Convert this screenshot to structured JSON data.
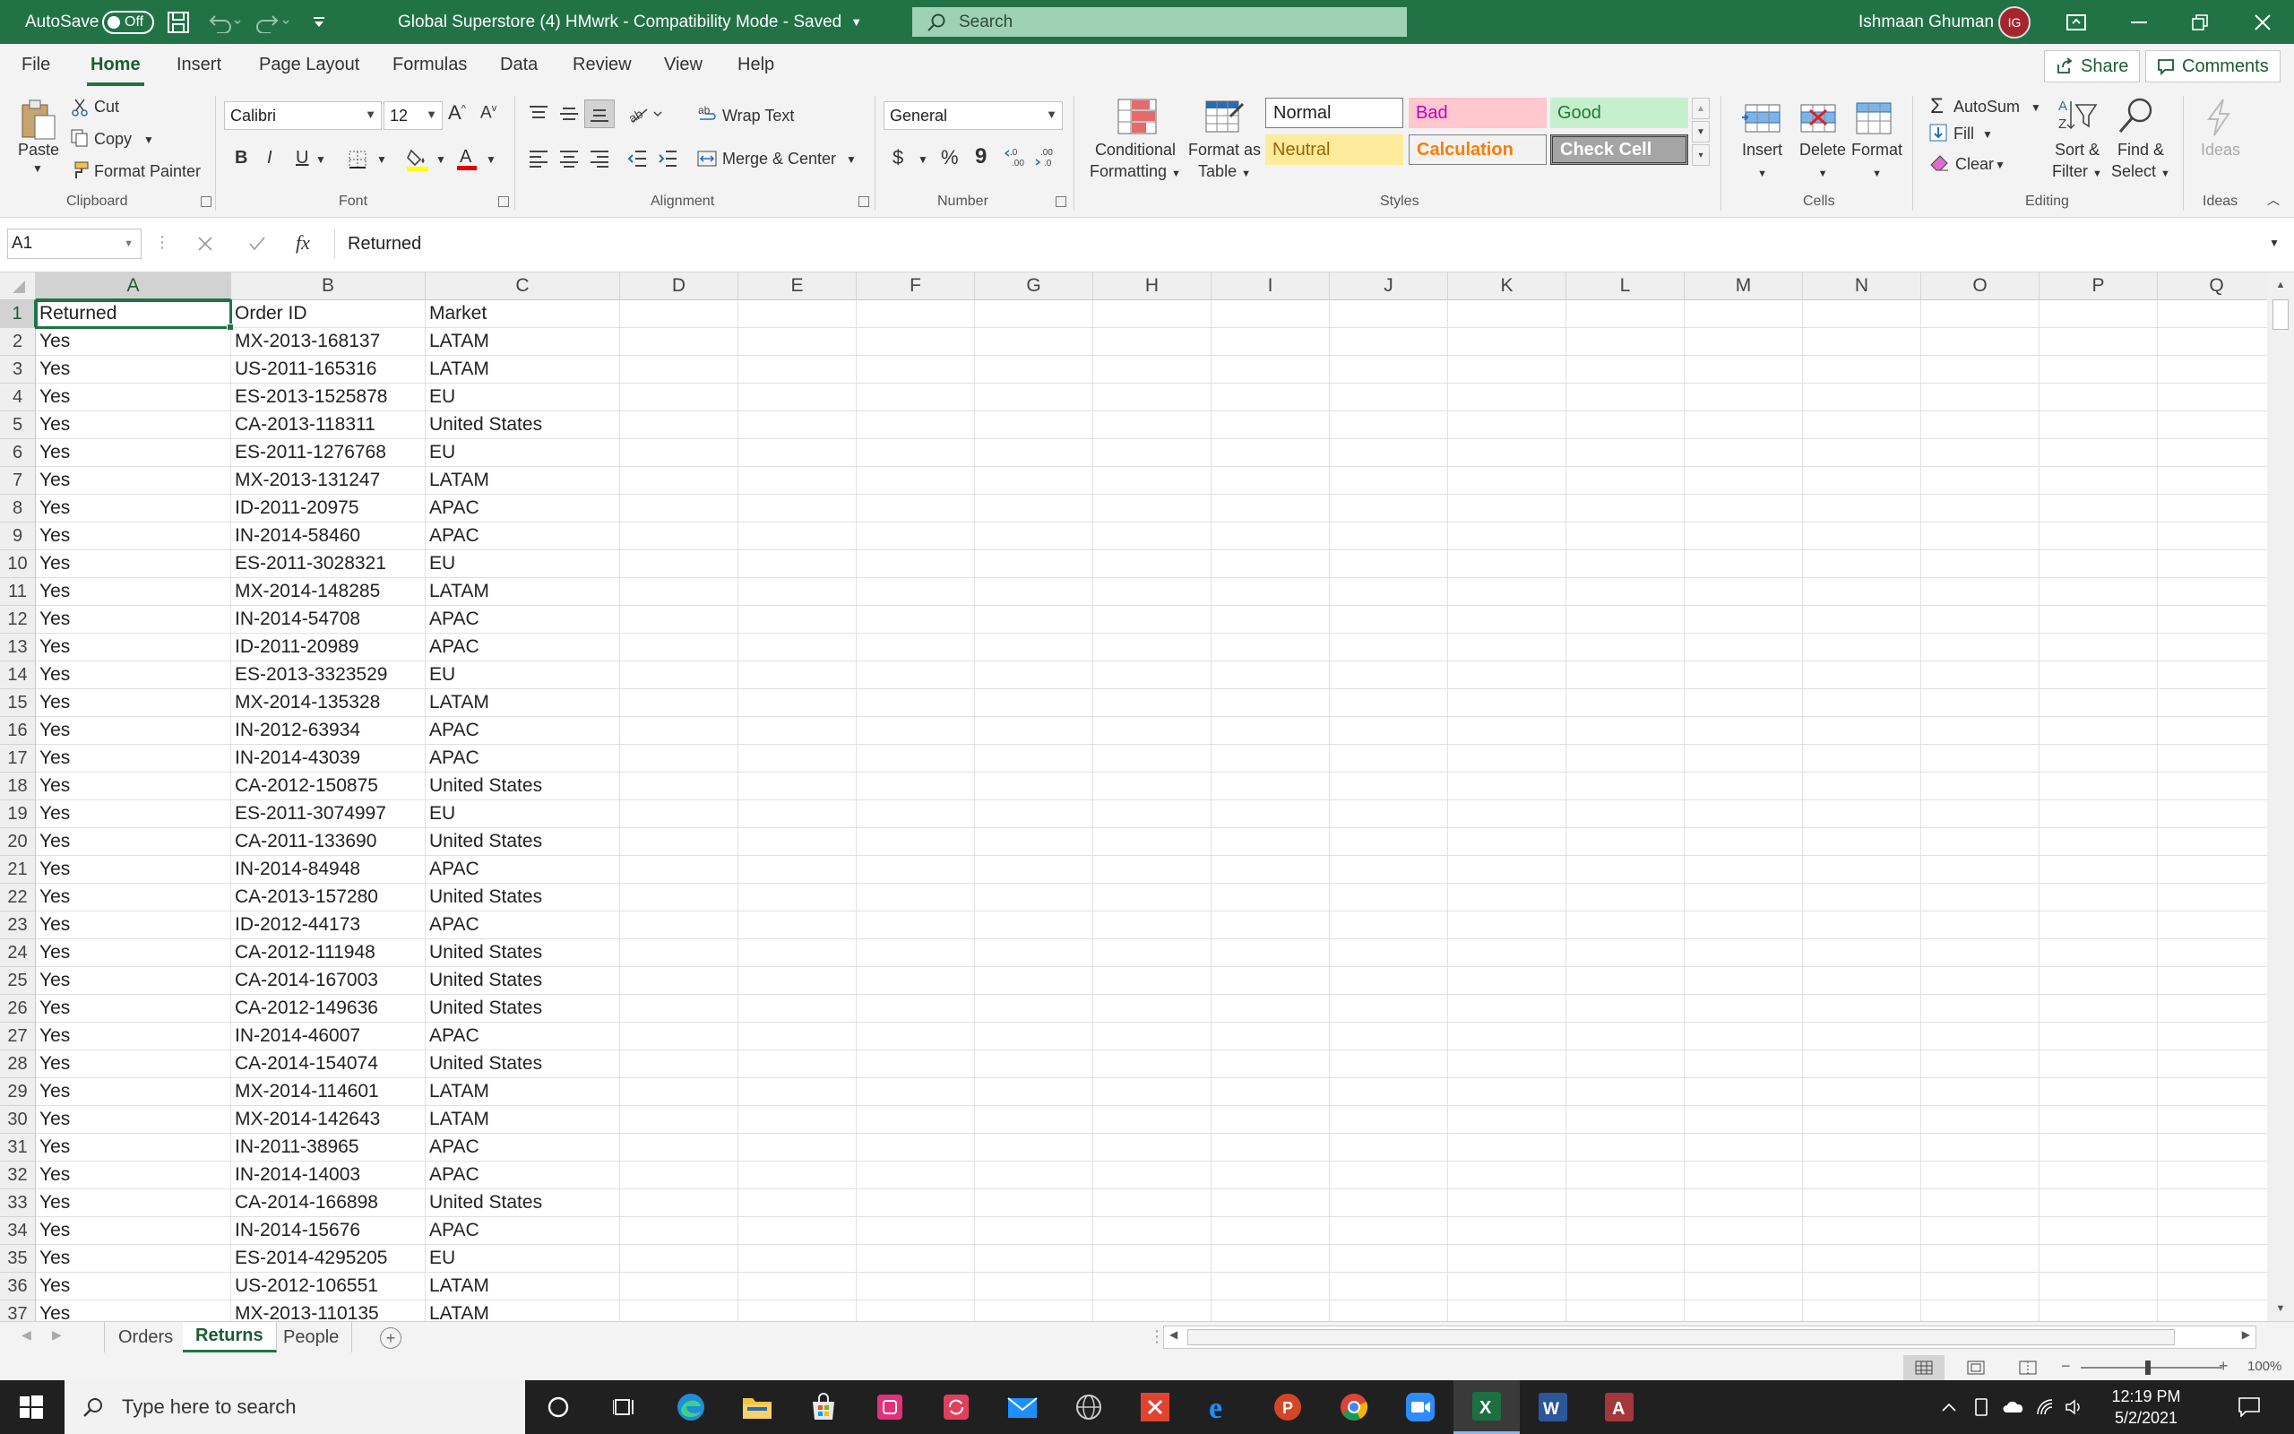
{
  "titlebar": {
    "autosave_label": "AutoSave",
    "autosave_state": "Off",
    "doc_title": "Global Superstore (4) HMwrk  -  Compatibility Mode  -  Saved",
    "search_placeholder": "Search",
    "user_name": "Ishmaan Ghuman",
    "user_initials": "IG"
  },
  "ribbon_tabs": [
    "File",
    "Home",
    "Insert",
    "Page Layout",
    "Formulas",
    "Data",
    "Review",
    "View",
    "Help"
  ],
  "share_label": "Share",
  "comments_label": "Comments",
  "clipboard": {
    "paste": "Paste",
    "cut": "Cut",
    "copy": "Copy",
    "format_painter": "Format Painter",
    "group": "Clipboard"
  },
  "font": {
    "name": "Calibri",
    "size": "12",
    "group": "Font",
    "bold": "B",
    "italic": "I",
    "underline": "U"
  },
  "alignment": {
    "wrap": "Wrap Text",
    "merge": "Merge & Center",
    "group": "Alignment"
  },
  "number": {
    "format": "General",
    "group": "Number",
    "currency": "$",
    "percent": "%",
    "comma": "9"
  },
  "styles": {
    "conditional": [
      "Conditional",
      "Formatting"
    ],
    "format_table": [
      "Format as",
      "Table"
    ],
    "normal": "Normal",
    "bad": "Bad",
    "good": "Good",
    "neutral": "Neutral",
    "calculation": "Calculation",
    "check_cell": "Check Cell",
    "group": "Styles"
  },
  "cells": {
    "insert": "Insert",
    "delete": "Delete",
    "format": "Format",
    "group": "Cells"
  },
  "editing": {
    "autosum": "AutoSum",
    "fill": "Fill",
    "clear": "Clear",
    "sort": [
      "Sort &",
      "Filter"
    ],
    "find": [
      "Find &",
      "Select"
    ],
    "group": "Editing"
  },
  "ideas": {
    "label": "Ideas",
    "group": "Ideas"
  },
  "formula_bar": {
    "name_box": "A1",
    "fx": "fx",
    "content": "Returned"
  },
  "columns": [
    "A",
    "B",
    "C",
    "D",
    "E",
    "F",
    "G",
    "H",
    "I",
    "J",
    "K",
    "L",
    "M",
    "N",
    "O",
    "P",
    "Q"
  ],
  "sheet": {
    "rows": [
      [
        "Returned",
        "Order ID",
        "Market"
      ],
      [
        "Yes",
        "MX-2013-168137",
        "LATAM"
      ],
      [
        "Yes",
        "US-2011-165316",
        "LATAM"
      ],
      [
        "Yes",
        "ES-2013-1525878",
        "EU"
      ],
      [
        "Yes",
        "CA-2013-118311",
        "United States"
      ],
      [
        "Yes",
        "ES-2011-1276768",
        "EU"
      ],
      [
        "Yes",
        "MX-2013-131247",
        "LATAM"
      ],
      [
        "Yes",
        "ID-2011-20975",
        "APAC"
      ],
      [
        "Yes",
        "IN-2014-58460",
        "APAC"
      ],
      [
        "Yes",
        "ES-2011-3028321",
        "EU"
      ],
      [
        "Yes",
        "MX-2014-148285",
        "LATAM"
      ],
      [
        "Yes",
        "IN-2014-54708",
        "APAC"
      ],
      [
        "Yes",
        "ID-2011-20989",
        "APAC"
      ],
      [
        "Yes",
        "ES-2013-3323529",
        "EU"
      ],
      [
        "Yes",
        "MX-2014-135328",
        "LATAM"
      ],
      [
        "Yes",
        "IN-2012-63934",
        "APAC"
      ],
      [
        "Yes",
        "IN-2014-43039",
        "APAC"
      ],
      [
        "Yes",
        "CA-2012-150875",
        "United States"
      ],
      [
        "Yes",
        "ES-2011-3074997",
        "EU"
      ],
      [
        "Yes",
        "CA-2011-133690",
        "United States"
      ],
      [
        "Yes",
        "IN-2014-84948",
        "APAC"
      ],
      [
        "Yes",
        "CA-2013-157280",
        "United States"
      ],
      [
        "Yes",
        "ID-2012-44173",
        "APAC"
      ],
      [
        "Yes",
        "CA-2012-111948",
        "United States"
      ],
      [
        "Yes",
        "CA-2014-167003",
        "United States"
      ],
      [
        "Yes",
        "CA-2012-149636",
        "United States"
      ],
      [
        "Yes",
        "IN-2014-46007",
        "APAC"
      ],
      [
        "Yes",
        "CA-2014-154074",
        "United States"
      ],
      [
        "Yes",
        "MX-2014-114601",
        "LATAM"
      ],
      [
        "Yes",
        "MX-2014-142643",
        "LATAM"
      ],
      [
        "Yes",
        "IN-2011-38965",
        "APAC"
      ],
      [
        "Yes",
        "IN-2014-14003",
        "APAC"
      ],
      [
        "Yes",
        "CA-2014-166898",
        "United States"
      ],
      [
        "Yes",
        "IN-2014-15676",
        "APAC"
      ],
      [
        "Yes",
        "ES-2014-4295205",
        "EU"
      ],
      [
        "Yes",
        "US-2012-106551",
        "LATAM"
      ],
      [
        "Yes",
        "MX-2013-110135",
        "LATAM"
      ]
    ]
  },
  "sheet_tabs": [
    "Orders",
    "Returns",
    "People"
  ],
  "active_sheet": "Returns",
  "zoom": "100%",
  "taskbar": {
    "search_placeholder": "Type here to search",
    "time": "12:19 PM",
    "date": "5/2/2021"
  },
  "colors": {
    "excel_green": "#217346",
    "taskbar": "#202020"
  }
}
